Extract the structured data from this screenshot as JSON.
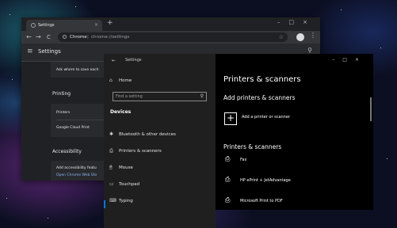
{
  "chrome": {
    "tab_title": "Settings",
    "tab_close": "×",
    "new_tab": "+",
    "window_controls": "–□×",
    "back": "←",
    "forward": "→",
    "reload": "C",
    "omnibox_host": "Chrome",
    "omnibox_sep": "|",
    "omnibox_path": "chrome://settings",
    "bookmark": "☆",
    "menu": "⋮"
  },
  "settings": {
    "title": "Settings",
    "rows": {
      "ask_save": "Ask where to save each",
      "printing": "Printing",
      "printers": "Printers",
      "gcp": "Google Cloud Print",
      "accessibility": "Accessibility",
      "add_access": "Add accessibility featu",
      "open_store": "Open Chrome Web Sto"
    }
  },
  "win_settings": {
    "title": "Settings",
    "back": "←",
    "home": "Home",
    "search_placeholder": "Find a setting",
    "devices_heading": "Devices",
    "items": [
      {
        "label": "Bluetooth & other devices",
        "icon": "bluetooth-icon",
        "glyph": "✱"
      },
      {
        "label": "Printers & scanners",
        "icon": "printer-icon",
        "glyph": "⎙"
      },
      {
        "label": "Mouse",
        "icon": "mouse-icon",
        "glyph": "🖱"
      },
      {
        "label": "Touchpad",
        "icon": "touchpad-icon",
        "glyph": "▭"
      },
      {
        "label": "Typing",
        "icon": "keyboard-icon",
        "glyph": "⌨"
      }
    ]
  },
  "pane": {
    "window_controls": "–□×",
    "title": "Printers & scanners",
    "add_heading": "Add printers & scanners",
    "add_label": "Add a printer or scanner",
    "list_heading": "Printers & scanners",
    "printers": [
      "Fax",
      "HP ePrint + JetAdvantage",
      "Microsoft Print to PDF"
    ]
  },
  "colors": {
    "accent": "#0078d7",
    "chrome_link": "#8ab4f8"
  }
}
